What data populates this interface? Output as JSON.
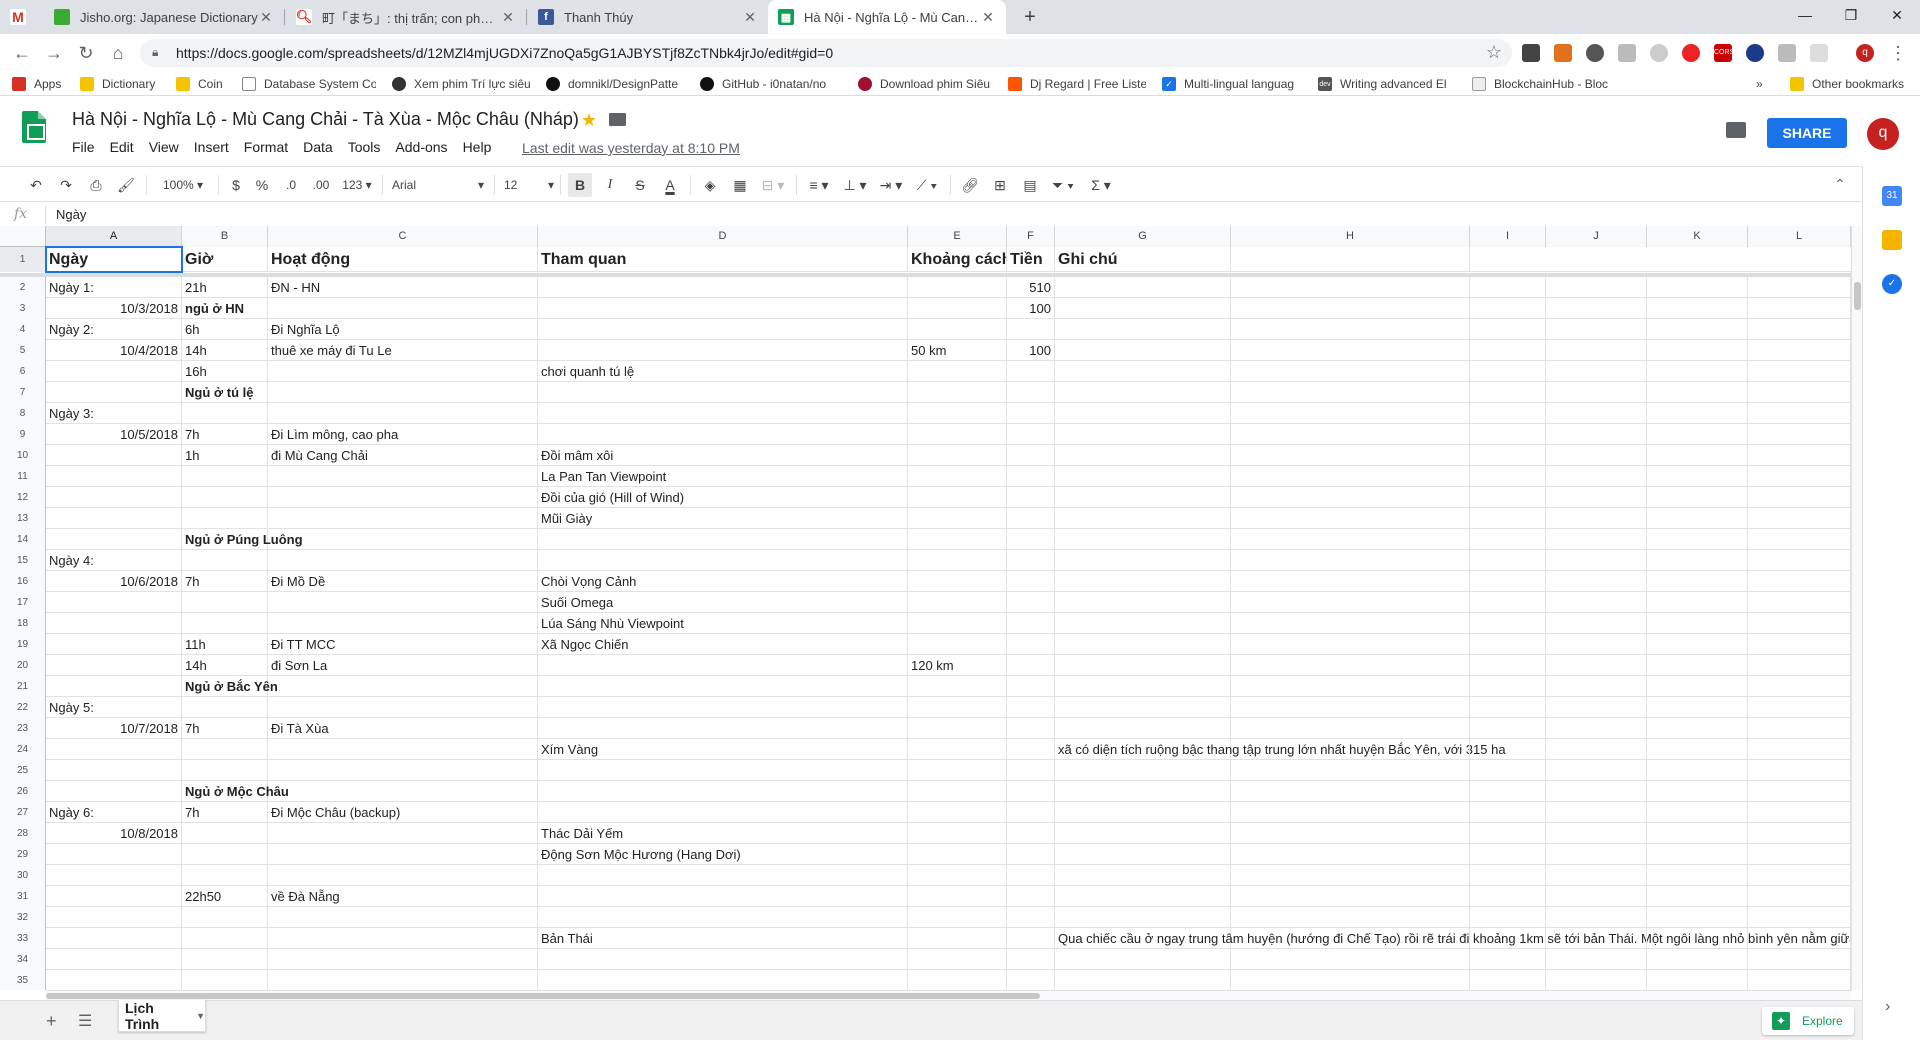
{
  "browser": {
    "tabs": [
      {
        "title": "Jisho.org: Japanese Dictionary",
        "favicon": "jisho-icon",
        "active": false
      },
      {
        "title": "町「まち」: thị trấn; con phố . | Ng",
        "favicon": "search-icon",
        "active": false
      },
      {
        "title": "Thanh Thúy",
        "favicon": "facebook-icon",
        "active": false
      },
      {
        "title": "Hà Nội - Nghĩa Lộ - Mù Cang Ch",
        "favicon": "sheets-icon",
        "active": true
      }
    ],
    "url": "https://docs.google.com/spreadsheets/d/12MZl4mjUGDXi7ZnoQa5gG1AJBYSTjf8ZcTNbk4jrJo/edit#gid=0",
    "bookmarks": [
      {
        "label": "Apps",
        "icon": "apps-icon"
      },
      {
        "label": "Dictionary",
        "icon": "folder-icon"
      },
      {
        "label": "Coin",
        "icon": "folder-icon"
      },
      {
        "label": "Database System Co",
        "icon": "page-icon"
      },
      {
        "label": "Xem phim Trí lực siêu",
        "icon": "film-icon"
      },
      {
        "label": "domnikl/DesignPatte",
        "icon": "github-icon"
      },
      {
        "label": "GitHub - i0natan/no",
        "icon": "github-icon"
      },
      {
        "label": "Download phim Siêu",
        "icon": "raspberry-icon"
      },
      {
        "label": "Dj Regard | Free Liste",
        "icon": "soundcloud-icon"
      },
      {
        "label": "Multi-lingual languag",
        "icon": "check-icon"
      },
      {
        "label": "Writing advanced El",
        "icon": "dev-icon"
      },
      {
        "label": "BlockchainHub - Bloc",
        "icon": "blockchain-icon"
      }
    ],
    "bookmarks_more": "»",
    "other_bookmarks": "Other bookmarks"
  },
  "doc": {
    "title": "Hà Nội - Nghĩa Lộ - Mù Cang Chải - Tà Xùa - Mộc Châu (Nháp)",
    "menu": [
      "File",
      "Edit",
      "View",
      "Insert",
      "Format",
      "Data",
      "Tools",
      "Add-ons",
      "Help"
    ],
    "last_edit": "Last edit was yesterday at 8:10 PM",
    "share_label": "SHARE",
    "avatar_letter": "q"
  },
  "toolbar": {
    "zoom": "100%",
    "currency": "$",
    "percent": "%",
    "dec_decrease": ".0",
    "dec_increase": ".00",
    "more_formats": "123",
    "font": "Arial",
    "font_size": "12",
    "bold": "B",
    "italic": "I",
    "strike": "S",
    "text_color": "A",
    "function": "Σ"
  },
  "formula_bar": {
    "label": "fx",
    "value": "Ngày"
  },
  "sheet": {
    "columns": [
      "A",
      "B",
      "C",
      "D",
      "E",
      "F",
      "G",
      "H",
      "I",
      "J",
      "K",
      "L"
    ],
    "header_row": [
      "Ngày",
      "Giờ",
      "Hoạt động",
      "Tham quan",
      "Khoảng cách",
      "Tiền",
      "Ghi chú"
    ],
    "rows": [
      {
        "n": "2",
        "a": "Ngày 1:",
        "b": "21h",
        "c": "ĐN - HN",
        "d": "",
        "e": "",
        "f": "510",
        "g": ""
      },
      {
        "n": "3",
        "a": "10/3/2018",
        "b": "ngủ ở HN",
        "c": "",
        "d": "",
        "e": "",
        "f": "100",
        "g": ""
      },
      {
        "n": "4",
        "a": "Ngày 2:",
        "b": "6h",
        "c": "Đi Nghĩa Lộ",
        "d": "",
        "e": "",
        "f": "",
        "g": ""
      },
      {
        "n": "5",
        "a": "10/4/2018",
        "b": "14h",
        "c": "thuê xe máy đi Tu Le",
        "d": "",
        "e": "50 km",
        "f": "100",
        "g": ""
      },
      {
        "n": "6",
        "a": "",
        "b": "16h",
        "c": "",
        "d": "chơi quanh tú lệ",
        "e": "",
        "f": "",
        "g": ""
      },
      {
        "n": "7",
        "a": "",
        "b": "Ngủ ở tú lệ",
        "c": "",
        "d": "",
        "e": "",
        "f": "",
        "g": ""
      },
      {
        "n": "8",
        "a": "Ngày 3:",
        "b": "",
        "c": "",
        "d": "",
        "e": "",
        "f": "",
        "g": ""
      },
      {
        "n": "9",
        "a": "10/5/2018",
        "b": "7h",
        "c": "Đi Lìm mông, cao pha",
        "d": "",
        "e": "",
        "f": "",
        "g": ""
      },
      {
        "n": "10",
        "a": "",
        "b": "1h",
        "c": "đi Mù Cang Chải",
        "d": "Đồi mâm xôi",
        "e": "",
        "f": "",
        "g": ""
      },
      {
        "n": "11",
        "a": "",
        "b": "",
        "c": "",
        "d": "La Pan Tan Viewpoint",
        "e": "",
        "f": "",
        "g": ""
      },
      {
        "n": "12",
        "a": "",
        "b": "",
        "c": "",
        "d": "Đồi của gió (Hill of Wind)",
        "e": "",
        "f": "",
        "g": ""
      },
      {
        "n": "13",
        "a": "",
        "b": "",
        "c": "",
        "d": "Mũi Giày",
        "e": "",
        "f": "",
        "g": ""
      },
      {
        "n": "14",
        "a": "",
        "b": "Ngủ ở Púng Luông",
        "c": "",
        "d": "",
        "e": "",
        "f": "",
        "g": ""
      },
      {
        "n": "15",
        "a": "Ngày 4:",
        "b": "",
        "c": "",
        "d": "",
        "e": "",
        "f": "",
        "g": ""
      },
      {
        "n": "16",
        "a": "10/6/2018",
        "b": "7h",
        "c": "Đi Mồ Dề",
        "d": "Chòi Vọng Cảnh",
        "e": "",
        "f": "",
        "g": ""
      },
      {
        "n": "17",
        "a": "",
        "b": "",
        "c": "",
        "d": "Suối Omega",
        "e": "",
        "f": "",
        "g": ""
      },
      {
        "n": "18",
        "a": "",
        "b": "",
        "c": "",
        "d": "Lúa Sáng Nhù Viewpoint",
        "e": "",
        "f": "",
        "g": ""
      },
      {
        "n": "19",
        "a": "",
        "b": "11h",
        "c": "Đi TT MCC",
        "d": "Xã Ngọc Chiến",
        "e": "",
        "f": "",
        "g": ""
      },
      {
        "n": "20",
        "a": "",
        "b": "14h",
        "c": "đi Sơn La",
        "d": "",
        "e": "120 km",
        "f": "",
        "g": ""
      },
      {
        "n": "21",
        "a": "",
        "b": "Ngủ ở Bắc Yên",
        "c": "",
        "d": "",
        "e": "",
        "f": "",
        "g": ""
      },
      {
        "n": "22",
        "a": "Ngày 5:",
        "b": "",
        "c": "",
        "d": "",
        "e": "",
        "f": "",
        "g": ""
      },
      {
        "n": "23",
        "a": "10/7/2018",
        "b": "7h",
        "c": "Đi Tà Xùa",
        "d": "",
        "e": "",
        "f": "",
        "g": ""
      },
      {
        "n": "24",
        "a": "",
        "b": "",
        "c": "",
        "d": "Xím Vàng",
        "e": "",
        "f": "",
        "g": "xã có diện tích ruộng bậc thang tập trung lớn nhất huyện Bắc Yên, với 315 ha"
      },
      {
        "n": "25",
        "a": "",
        "b": "",
        "c": "",
        "d": "",
        "e": "",
        "f": "",
        "g": ""
      },
      {
        "n": "26",
        "a": "",
        "b": "Ngủ ở Mộc Châu",
        "c": "",
        "d": "",
        "e": "",
        "f": "",
        "g": ""
      },
      {
        "n": "27",
        "a": "Ngày 6:",
        "b": "7h",
        "c": "Đi Mộc Châu (backup)",
        "d": "",
        "e": "",
        "f": "",
        "g": ""
      },
      {
        "n": "28",
        "a": "10/8/2018",
        "b": "",
        "c": "",
        "d": "Thác Dải Yếm",
        "e": "",
        "f": "",
        "g": ""
      },
      {
        "n": "29",
        "a": "",
        "b": "",
        "c": "",
        "d": "Động Sơn Mộc Hương (Hang Dơi)",
        "e": "",
        "f": "",
        "g": ""
      },
      {
        "n": "30",
        "a": "",
        "b": "",
        "c": "",
        "d": "",
        "e": "",
        "f": "",
        "g": ""
      },
      {
        "n": "31",
        "a": "",
        "b": "22h50",
        "c": "về Đà Nẵng",
        "d": "",
        "e": "",
        "f": "",
        "g": ""
      },
      {
        "n": "32",
        "a": "",
        "b": "",
        "c": "",
        "d": "",
        "e": "",
        "f": "",
        "g": ""
      },
      {
        "n": "33",
        "a": "",
        "b": "",
        "c": "",
        "d": "Bản Thái",
        "e": "",
        "f": "",
        "g": "Qua chiếc cầu ở ngay trung tâm huyện (hướng đi Chế Tạo) rồi rẽ trái đi khoảng 1km sẽ tới bản Thái. Một ngôi làng nhỏ bình yên nằm giữa"
      },
      {
        "n": "34",
        "a": "",
        "b": "",
        "c": "",
        "d": "",
        "e": "",
        "f": "",
        "g": ""
      },
      {
        "n": "35",
        "a": "",
        "b": "",
        "c": "",
        "d": "",
        "e": "",
        "f": "",
        "g": ""
      }
    ],
    "bold_b_rows": [
      "3",
      "7",
      "14",
      "21",
      "26"
    ]
  },
  "sheet_tabs": {
    "active": "Lịch Trình",
    "explore_label": "Explore"
  },
  "colors": {
    "sheets_green": "#0f9d58",
    "share_blue": "#1a73e8",
    "selection_blue": "#1a73e8",
    "avatar_red": "#c5221f"
  }
}
